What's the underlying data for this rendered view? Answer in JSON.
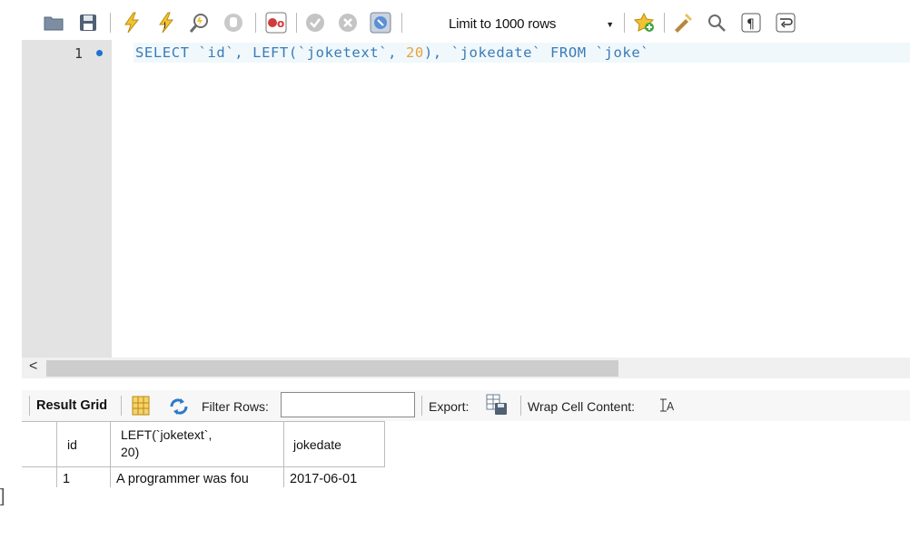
{
  "toolbar": {
    "icons": [
      "open-folder-icon",
      "save-icon",
      "execute-icon",
      "execute-current-icon",
      "explain-icon",
      "stop-icon",
      "toggle-error-icon",
      "commit-icon",
      "rollback-icon",
      "autocommit-icon",
      "add-snippet-icon",
      "beautify-icon",
      "find-icon",
      "invisible-chars-icon",
      "wrap-icon"
    ],
    "limit_label": "Limit to 1000 rows"
  },
  "editor": {
    "line_number": "1",
    "code": {
      "kw_select": "SELECT",
      "id": "`id`,",
      "left_fn": "LEFT(",
      "joketext": "`joketext`,",
      "num": "20",
      "close": "),",
      "jokedate": "`jokedate`",
      "kw_from": "FROM",
      "table": "`joke`"
    }
  },
  "result": {
    "tab_label": "Result Grid",
    "filter_label": "Filter Rows:",
    "filter_value": "",
    "export_label": "Export:",
    "wrap_label": "Wrap Cell Content:",
    "columns": [
      "id",
      "LEFT(`joketext`,",
      "20)",
      "jokedate"
    ],
    "rows": [
      {
        "id": "1",
        "text": "A programmer was fou",
        "date": "2017-06-01"
      }
    ]
  },
  "colors": {
    "keyword": "#3a7bb7",
    "number": "#e8a33c",
    "gutter": "#e3e3e3"
  }
}
